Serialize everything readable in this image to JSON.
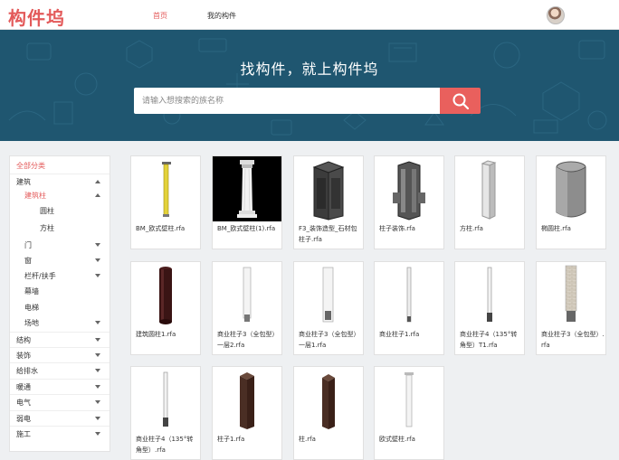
{
  "header": {
    "logo": "构件坞",
    "nav": [
      {
        "label": "首页",
        "active": true
      },
      {
        "label": "我的构件",
        "active": false
      }
    ]
  },
  "hero": {
    "title": "找构件，就上构件坞",
    "search_placeholder": "请输入想搜索的族名称"
  },
  "sidebar": {
    "all": "全部分类",
    "items": [
      {
        "label": "建筑",
        "arrow": "up"
      },
      {
        "label": "建筑柱",
        "arrow": "up",
        "highlight": true
      },
      {
        "label": "圆柱"
      },
      {
        "label": "方柱"
      },
      {
        "label": "门",
        "arrow": "down"
      },
      {
        "label": "窗",
        "arrow": "down"
      },
      {
        "label": "栏杆/扶手",
        "arrow": "down"
      },
      {
        "label": "幕墙"
      },
      {
        "label": "电梯"
      },
      {
        "label": "场地",
        "arrow": "down"
      },
      {
        "label": "结构",
        "arrow": "down"
      },
      {
        "label": "装饰",
        "arrow": "down"
      },
      {
        "label": "给排水",
        "arrow": "down"
      },
      {
        "label": "暖通",
        "arrow": "down"
      },
      {
        "label": "电气",
        "arrow": "down"
      },
      {
        "label": "弱电",
        "arrow": "down"
      },
      {
        "label": "施工",
        "arrow": "down"
      }
    ]
  },
  "components": [
    {
      "name": "BM_欧式壁柱.rfa",
      "icon": "yellow-column-icon"
    },
    {
      "name": "BM_欧式壁柱(1).rfa",
      "icon": "white-roman-column-icon"
    },
    {
      "name": "F3_装饰造型_石材包柱子.rfa",
      "icon": "stone-clad-column-icon"
    },
    {
      "name": "柱子装饰.rfa",
      "icon": "decorative-column-icon"
    },
    {
      "name": "方柱.rfa",
      "icon": "square-column-icon"
    },
    {
      "name": "椭圆柱.rfa",
      "icon": "elliptical-column-icon"
    },
    {
      "name": "建筑圆柱1.rfa",
      "icon": "dark-round-column-icon"
    },
    {
      "name": "商业柱子3（全包型）一层2.rfa",
      "icon": "commercial-column-icon"
    },
    {
      "name": "商业柱子3（全包型）一层1.rfa",
      "icon": "commercial-column-icon"
    },
    {
      "name": "商业柱子1.rfa",
      "icon": "thin-column-icon"
    },
    {
      "name": "商业柱子4（135°转角型）T1.rfa",
      "icon": "corner-column-icon"
    },
    {
      "name": "商业柱子3（全包型）.rfa",
      "icon": "brick-column-icon"
    },
    {
      "name": "商业柱子4（135°转角型）.rfa",
      "icon": "corner-column-icon"
    },
    {
      "name": "柱子1.rfa",
      "icon": "brown-square-column-icon"
    },
    {
      "name": "柱.rfa",
      "icon": "brown-square-column-icon"
    },
    {
      "name": "欧式壁柱.rfa",
      "icon": "white-pilaster-icon"
    }
  ]
}
